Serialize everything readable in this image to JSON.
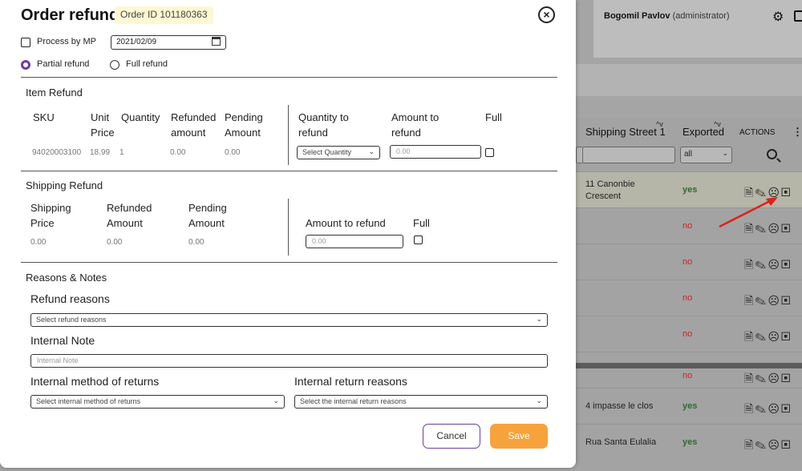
{
  "modal": {
    "title": "Order refund",
    "order_id": "Order ID 101180363",
    "process_by_mp_label": "Process by MP",
    "date_value": "2021/02/09",
    "partial_refund_label": "Partial refund",
    "full_refund_label": "Full refund",
    "item_refund": {
      "heading": "Item Refund",
      "col_sku": "SKU",
      "col_unit_price_1": "Unit",
      "col_unit_price_2": "Price",
      "col_quantity": "Quantity",
      "col_refunded_1": "Refunded",
      "col_refunded_2": "amount",
      "col_pending_1": "Pending",
      "col_pending_2": "Amount",
      "col_qty_to_refund_1": "Quantity to",
      "col_qty_to_refund_2": "refund",
      "col_amount_to_refund_1": "Amount to",
      "col_amount_to_refund_2": "refund",
      "col_full": "Full",
      "row": {
        "sku": "94020003100",
        "unit_price": "18.99",
        "quantity": "1",
        "refunded": "0.00",
        "pending": "0.00",
        "qty_select": "Select Quantity",
        "amount_placeholder": "0.00"
      }
    },
    "shipping_refund": {
      "heading": "Shipping Refund",
      "col_price_1": "Shipping",
      "col_price_2": "Price",
      "col_refunded_1": "Refunded",
      "col_refunded_2": "Amount",
      "col_pending_1": "Pending",
      "col_pending_2": "Amount",
      "col_amount_to_refund": "Amount to refund",
      "col_full": "Full",
      "price": "0.00",
      "refunded": "0.00",
      "pending": "0.00",
      "amount_placeholder": "0.00"
    },
    "reasons": {
      "heading": "Reasons & Notes",
      "refund_reasons_label": "Refund reasons",
      "refund_reasons_select": "Select refund reasons",
      "internal_note_label": "Internal Note",
      "internal_note_placeholder": "Internal Note",
      "method_label": "Internal method of returns",
      "method_select": "Select internal method of returns",
      "return_reasons_label": "Internal return reasons",
      "return_reasons_select": "Select the internal return reasons"
    },
    "cancel_label": "Cancel",
    "save_label": "Save"
  },
  "background": {
    "user_name": "Bogomil Pavlov",
    "user_role": "(administrator)",
    "col_shipping_street": "Shipping Street 1",
    "col_exported": "Exported",
    "col_actions": "ACTIONS",
    "exported_filter": "all",
    "rows": [
      {
        "street": "11 Canonbie Crescent",
        "exported": "yes"
      },
      {
        "street": "",
        "exported": "no"
      },
      {
        "street": "",
        "exported": "no"
      },
      {
        "street": "",
        "exported": "no"
      },
      {
        "street": "",
        "exported": "no"
      },
      {
        "street": "",
        "exported": "no"
      },
      {
        "street": "4 impasse le clos",
        "exported": "yes"
      },
      {
        "street": "Rua Santa Eulalia",
        "exported": "yes"
      }
    ]
  },
  "colors": {
    "accent_purple": "#6b3fa0",
    "save_orange": "#f7a23b",
    "arrow_red": "#e0201b",
    "yes_green": "#2e6b2e",
    "no_red": "#cc2222"
  }
}
